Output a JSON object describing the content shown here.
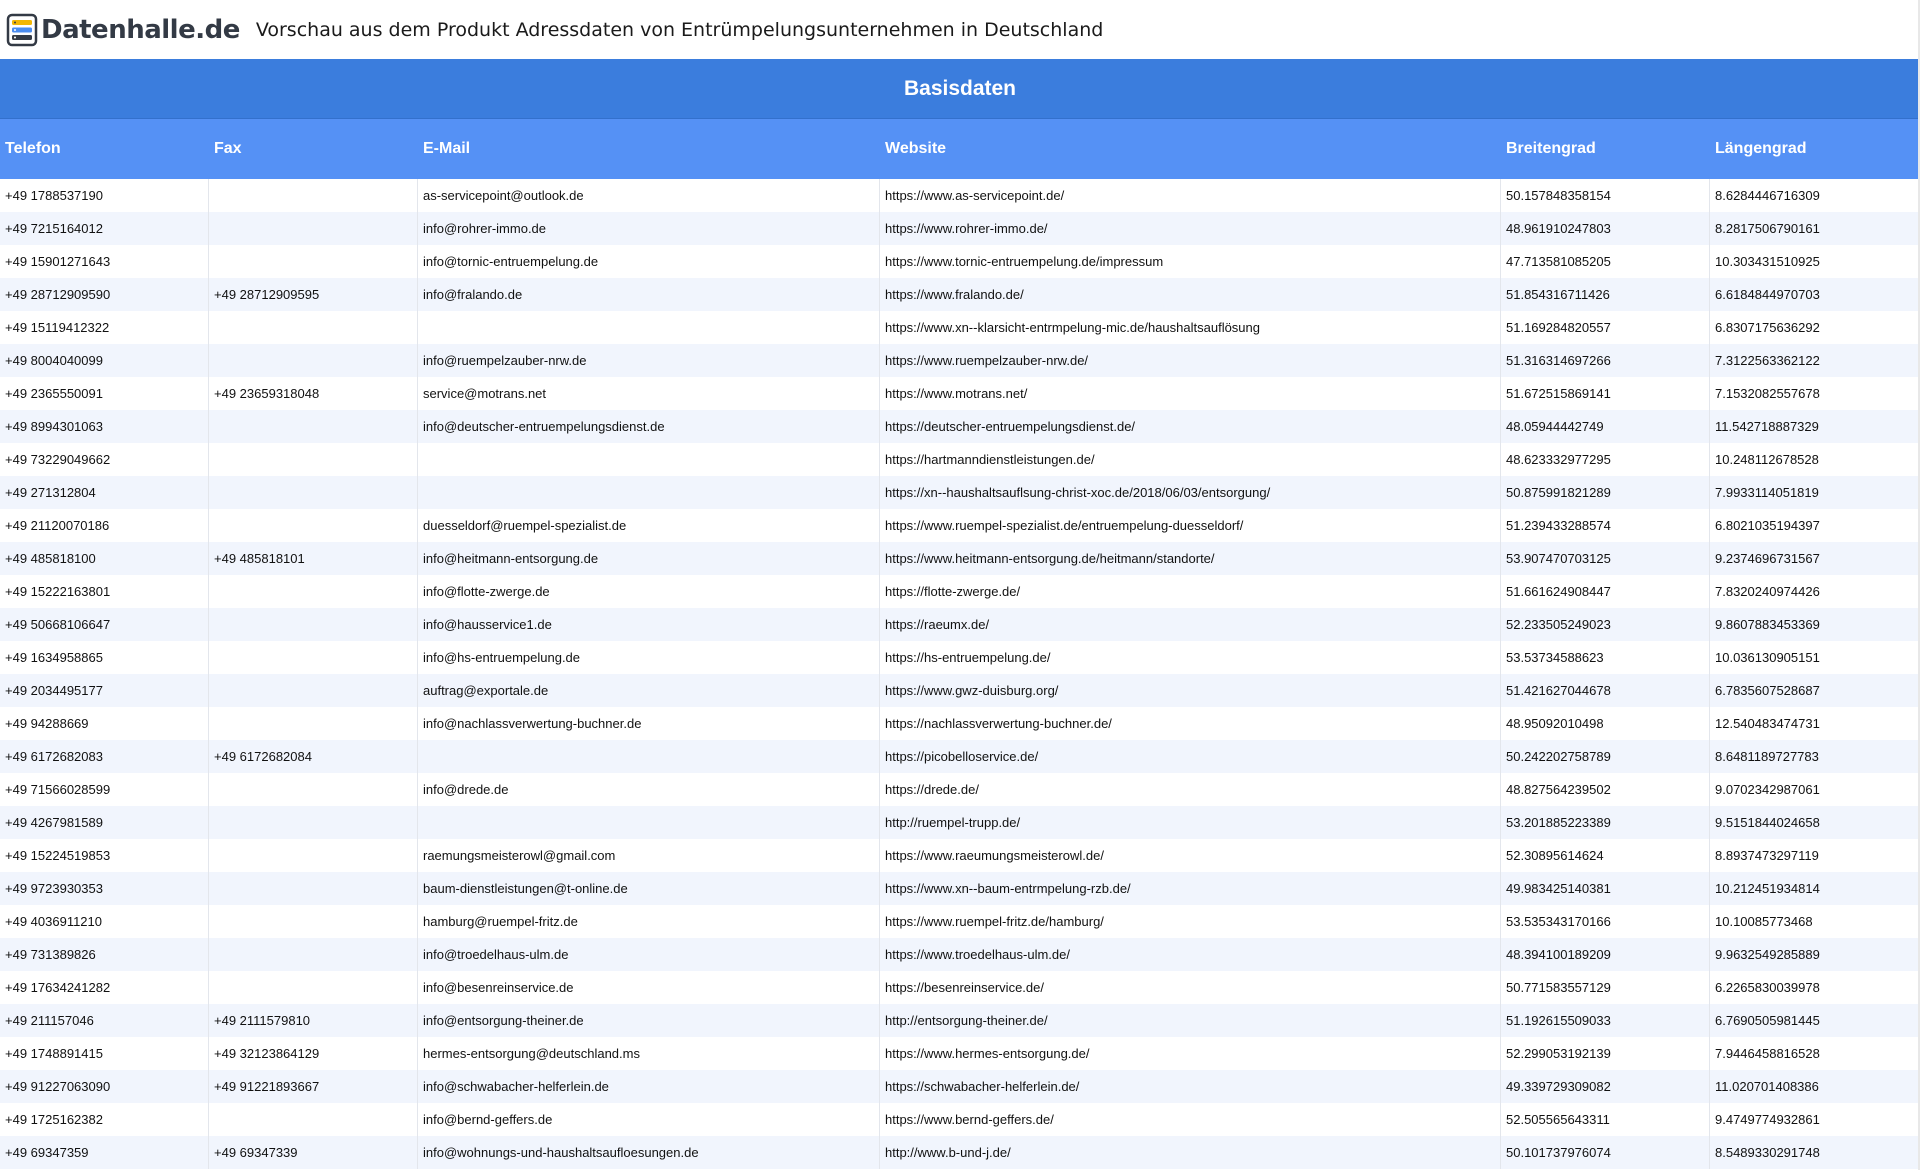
{
  "header": {
    "logo_text": "Datenhalle.de",
    "title": "Vorschau aus dem Produkt Adressdaten von Entrümpelungsunternehmen in Deutschland"
  },
  "table": {
    "group_title": "Basisdaten",
    "columns": [
      "Telefon",
      "Fax",
      "E-Mail",
      "Website",
      "Breitengrad",
      "Längengrad"
    ],
    "rows": [
      [
        "+49 1788537190",
        "",
        "as-servicepoint@outlook.de",
        "https://www.as-servicepoint.de/",
        "50.157848358154",
        "8.6284446716309"
      ],
      [
        "+49 7215164012",
        "",
        "info@rohrer-immo.de",
        "https://www.rohrer-immo.de/",
        "48.961910247803",
        "8.2817506790161"
      ],
      [
        "+49 15901271643",
        "",
        "info@tornic-entruempelung.de",
        "https://www.tornic-entruempelung.de/impressum",
        "47.713581085205",
        "10.303431510925"
      ],
      [
        "+49 28712909590",
        "+49 28712909595",
        "info@fralando.de",
        "https://www.fralando.de/",
        "51.854316711426",
        "6.6184844970703"
      ],
      [
        "+49 15119412322",
        "",
        "",
        "https://www.xn--klarsicht-entrmpelung-mic.de/haushaltsauflösung",
        "51.169284820557",
        "6.8307175636292"
      ],
      [
        "+49 8004040099",
        "",
        "info@ruempelzauber-nrw.de",
        "https://www.ruempelzauber-nrw.de/",
        "51.316314697266",
        "7.3122563362122"
      ],
      [
        "+49 2365550091",
        "+49 23659318048",
        "service@motrans.net",
        "https://www.motrans.net/",
        "51.672515869141",
        "7.1532082557678"
      ],
      [
        "+49 8994301063",
        "",
        "info@deutscher-entruempelungsdienst.de",
        "https://deutscher-entruempelungsdienst.de/",
        "48.05944442749",
        "11.542718887329"
      ],
      [
        "+49 73229049662",
        "",
        "",
        "https://hartmanndienstleistungen.de/",
        "48.623332977295",
        "10.248112678528"
      ],
      [
        "+49 271312804",
        "",
        "",
        "https://xn--haushaltsauflsung-christ-xoc.de/2018/06/03/entsorgung/",
        "50.875991821289",
        "7.9933114051819"
      ],
      [
        "+49 21120070186",
        "",
        "duesseldorf@ruempel-spezialist.de",
        "https://www.ruempel-spezialist.de/entruempelung-duesseldorf/",
        "51.239433288574",
        "6.8021035194397"
      ],
      [
        "+49 485818100",
        "+49 485818101",
        "info@heitmann-entsorgung.de",
        "https://www.heitmann-entsorgung.de/heitmann/standorte/",
        "53.907470703125",
        "9.2374696731567"
      ],
      [
        "+49 15222163801",
        "",
        "info@flotte-zwerge.de",
        "https://flotte-zwerge.de/",
        "51.661624908447",
        "7.8320240974426"
      ],
      [
        "+49 50668106647",
        "",
        "info@hausservice1.de",
        "https://raeumx.de/",
        "52.233505249023",
        "9.8607883453369"
      ],
      [
        "+49 1634958865",
        "",
        "info@hs-entruempelung.de",
        "https://hs-entruempelung.de/",
        "53.53734588623",
        "10.036130905151"
      ],
      [
        "+49 2034495177",
        "",
        "auftrag@exportale.de",
        "https://www.gwz-duisburg.org/",
        "51.421627044678",
        "6.7835607528687"
      ],
      [
        "+49 94288669",
        "",
        "info@nachlassverwertung-buchner.de",
        "https://nachlassverwertung-buchner.de/",
        "48.95092010498",
        "12.540483474731"
      ],
      [
        "+49 6172682083",
        "+49 6172682084",
        "",
        "https://picobelloservice.de/",
        "50.242202758789",
        "8.6481189727783"
      ],
      [
        "+49 71566028599",
        "",
        "info@drede.de",
        "https://drede.de/",
        "48.827564239502",
        "9.0702342987061"
      ],
      [
        "+49 4267981589",
        "",
        "",
        "http://ruempel-trupp.de/",
        "53.201885223389",
        "9.5151844024658"
      ],
      [
        "+49 15224519853",
        "",
        "raemungsmeisterowl@gmail.com",
        "https://www.raeumungsmeisterowl.de/",
        "52.30895614624",
        "8.8937473297119"
      ],
      [
        "+49 9723930353",
        "",
        "baum-dienstleistungen@t-online.de",
        "https://www.xn--baum-entrmpelung-rzb.de/",
        "49.983425140381",
        "10.212451934814"
      ],
      [
        "+49 4036911210",
        "",
        "hamburg@ruempel-fritz.de",
        "https://www.ruempel-fritz.de/hamburg/",
        "53.535343170166",
        "10.10085773468"
      ],
      [
        "+49 731389826",
        "",
        "info@troedelhaus-ulm.de",
        "https://www.troedelhaus-ulm.de/",
        "48.394100189209",
        "9.9632549285889"
      ],
      [
        "+49 17634241282",
        "",
        "info@besenreinservice.de",
        "https://besenreinservice.de/",
        "50.771583557129",
        "6.2265830039978"
      ],
      [
        "+49 211157046",
        "+49 2111579810",
        "info@entsorgung-theiner.de",
        "http://entsorgung-theiner.de/",
        "51.192615509033",
        "6.7690505981445"
      ],
      [
        "+49 1748891415",
        "+49 32123864129",
        "hermes-entsorgung@deutschland.ms",
        "https://www.hermes-entsorgung.de/",
        "52.299053192139",
        "7.9446458816528"
      ],
      [
        "+49 91227063090",
        "+49 91221893667",
        "info@schwabacher-helferlein.de",
        "https://schwabacher-helferlein.de/",
        "49.339729309082",
        "11.020701408386"
      ],
      [
        "+49 1725162382",
        "",
        "info@bernd-geffers.de",
        "https://www.bernd-geffers.de/",
        "52.505565643311",
        "9.4749774932861"
      ],
      [
        "+49 69347359",
        "+49 69347339",
        "info@wohnungs-und-haushaltsaufloesungen.de",
        "http://www.b-und-j.de/",
        "50.101737976074",
        "8.5489330291748"
      ]
    ]
  }
}
